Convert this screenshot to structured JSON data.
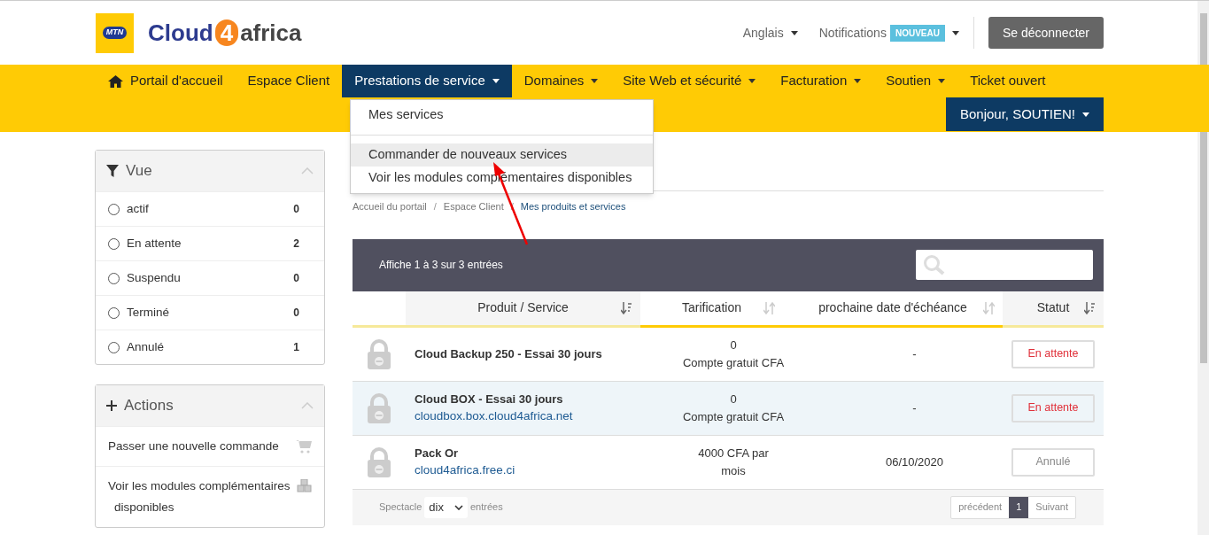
{
  "header": {
    "logo_badge": "MTN",
    "logo_text_left": "Cloud",
    "logo_text_digit": "4",
    "logo_text_right": "africa",
    "language": "Anglais",
    "notifications": "Notifications",
    "notifications_badge": "NOUVEAU",
    "logout": "Se déconnecter"
  },
  "nav": {
    "items": [
      {
        "label": "Portail d'accueil",
        "kind": "home",
        "selected": false
      },
      {
        "label": "Espace Client",
        "kind": "plain",
        "selected": false
      },
      {
        "label": "Prestations de service",
        "kind": "dropdown",
        "selected": true
      },
      {
        "label": "Domaines",
        "kind": "dropdown",
        "selected": false
      },
      {
        "label": "Site Web et sécurité",
        "kind": "dropdown",
        "selected": false
      },
      {
        "label": "Facturation",
        "kind": "dropdown",
        "selected": false
      },
      {
        "label": "Soutien",
        "kind": "dropdown",
        "selected": false
      },
      {
        "label": "Ticket ouvert",
        "kind": "plain",
        "selected": false
      }
    ],
    "user_menu": "Bonjour, SOUTIEN!"
  },
  "dropdown": {
    "items": [
      {
        "label": "Mes services",
        "selected": false
      },
      {
        "label": "Commander de nouveaux services",
        "selected": true
      },
      {
        "label": "Voir les modules complémentaires disponibles",
        "selected": false
      }
    ]
  },
  "sidebar": {
    "view": {
      "title": "Vue",
      "items": [
        {
          "label": "actif",
          "count": "0",
          "selected": false
        },
        {
          "label": "En attente",
          "count": "2",
          "selected": false
        },
        {
          "label": "Suspendu",
          "count": "0",
          "selected": false
        },
        {
          "label": "Terminé",
          "count": "0",
          "selected": false
        },
        {
          "label": "Annulé",
          "count": "1",
          "selected": false
        }
      ]
    },
    "actions": {
      "title": "Actions",
      "items": [
        {
          "label": "Passer une nouvelle commande",
          "kind": "cart"
        },
        {
          "label": "Voir les modules complémentaires disponibles",
          "kind": "cubes"
        }
      ]
    }
  },
  "breadcrumb_separator": "/",
  "breadcrumb": [
    {
      "label": "Accueil du portail",
      "current": false
    },
    {
      "label": "Espace Client",
      "current": false
    },
    {
      "label": "Mes produits et services",
      "current": true
    }
  ],
  "table": {
    "info": "Affiche 1 à 3 sur 3 entrées",
    "columns": [
      {
        "label": "Produit / Service",
        "sorted": true
      },
      {
        "label": "Tarification",
        "sorted": false
      },
      {
        "label": "prochaine date d'échéance",
        "sorted": false
      },
      {
        "label": "Statut",
        "sorted": true
      }
    ],
    "rows": [
      {
        "product": "Cloud Backup 250 - Essai 30 jours",
        "domain": "",
        "price": "0",
        "price_note": "Compte gratuit CFA",
        "due": "-",
        "status": "En attente",
        "kind": "pending",
        "highlighted": false
      },
      {
        "product": "Cloud BOX - Essai 30 jours",
        "domain": "cloudbox.box.cloud4africa.net",
        "price": "0",
        "price_note": "Compte gratuit CFA",
        "due": "-",
        "status": "En attente",
        "kind": "pending",
        "highlighted": true
      },
      {
        "product": "Pack Or",
        "domain": "cloud4africa.free.ci",
        "price": "4000 CFA par",
        "price_note": "mois",
        "due": "06/10/2020",
        "status": "Annulé",
        "kind": "cancelled",
        "highlighted": false
      }
    ],
    "footer": {
      "show_label": "Spectacle",
      "page_size": "dix",
      "entries_label": "entrées",
      "prev": "précédent",
      "pages": [
        {
          "label": "1",
          "selected": true
        }
      ],
      "next": "Suivant"
    }
  }
}
